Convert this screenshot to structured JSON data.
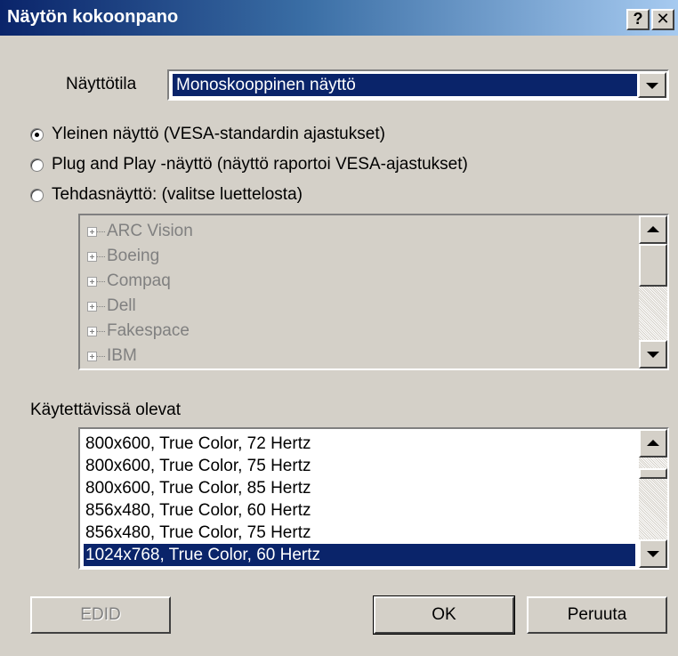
{
  "window": {
    "title": "Näytön kokoonpano",
    "help_label": "?",
    "close_label": "✕"
  },
  "display_mode": {
    "label": "Näyttötila",
    "value": "Monoskooppinen näyttö"
  },
  "radios": [
    {
      "label": "Yleinen näyttö (VESA-standardin ajastukset)",
      "checked": true
    },
    {
      "label": "Plug and Play -näyttö (näyttö raportoi VESA-ajastukset)",
      "checked": false
    },
    {
      "label": "Tehdasnäyttö: (valitse luettelosta)",
      "checked": false
    }
  ],
  "manufacturers": [
    "ARC Vision",
    "Boeing",
    "Compaq",
    "Dell",
    "Fakespace",
    "IBM"
  ],
  "available": {
    "label": "Käytettävissä olevat",
    "items": [
      "800x600, True Color, 72 Hertz",
      "800x600, True Color, 75 Hertz",
      "800x600, True Color, 85 Hertz",
      "856x480, True Color, 60 Hertz",
      "856x480, True Color, 75 Hertz",
      "1024x768, True Color, 60 Hertz"
    ],
    "selected_item": "1024x768, True Color, 60 Hertz"
  },
  "buttons": {
    "edid": "EDID",
    "ok": "OK",
    "cancel": "Peruuta"
  },
  "colors": {
    "dialog_bg": "#d4d0c8",
    "title_start": "#0a246a",
    "title_end": "#a6caf0",
    "selection": "#0a246a",
    "disabled_text": "#808080"
  }
}
